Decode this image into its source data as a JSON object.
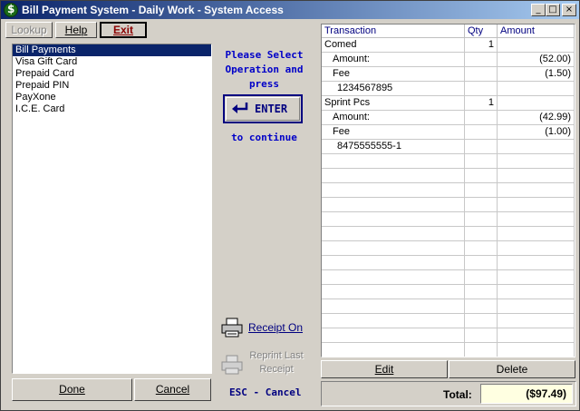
{
  "window": {
    "title": "Bill Payment System - Daily Work - System Access",
    "controls": {
      "minimize": "_",
      "maximize": "□",
      "close": "×"
    }
  },
  "menu": {
    "lookup": "Lookup",
    "help": "Help",
    "exit": "Exit"
  },
  "operations": [
    "Bill Payments",
    "Visa Gift Card",
    "Prepaid Card",
    "Prepaid PIN",
    "PayXone",
    "I.C.E. Card"
  ],
  "left_buttons": {
    "done": "Done",
    "cancel": "Cancel"
  },
  "center": {
    "prompt_line1": "Please Select",
    "prompt_line2": "Operation and",
    "prompt_line3": "press",
    "enter_label": "ENTER",
    "continue_text": "to continue",
    "receipt_on": "Receipt On",
    "reprint_line1": "Reprint Last",
    "reprint_line2": "Receipt",
    "esc_cancel": "ESC - Cancel"
  },
  "grid": {
    "headers": {
      "transaction": "Transaction",
      "qty": "Qty",
      "amount": "Amount"
    },
    "rows": [
      {
        "transaction": "Comed",
        "qty": "1",
        "amount": ""
      },
      {
        "transaction": "Amount:",
        "qty": "",
        "amount": "(52.00)"
      },
      {
        "transaction": "Fee",
        "qty": "",
        "amount": "(1.50)"
      },
      {
        "transaction": "1234567895",
        "qty": "",
        "amount": ""
      },
      {
        "transaction": "Sprint Pcs",
        "qty": "1",
        "amount": ""
      },
      {
        "transaction": "Amount:",
        "qty": "",
        "amount": "(42.99)"
      },
      {
        "transaction": "Fee",
        "qty": "",
        "amount": "(1.00)"
      },
      {
        "transaction": "8475555555-1",
        "qty": "",
        "amount": ""
      },
      {
        "transaction": "",
        "qty": "",
        "amount": ""
      },
      {
        "transaction": "",
        "qty": "",
        "amount": ""
      },
      {
        "transaction": "",
        "qty": "",
        "amount": ""
      },
      {
        "transaction": "",
        "qty": "",
        "amount": ""
      },
      {
        "transaction": "",
        "qty": "",
        "amount": ""
      },
      {
        "transaction": "",
        "qty": "",
        "amount": ""
      },
      {
        "transaction": "",
        "qty": "",
        "amount": ""
      },
      {
        "transaction": "",
        "qty": "",
        "amount": ""
      },
      {
        "transaction": "",
        "qty": "",
        "amount": ""
      },
      {
        "transaction": "",
        "qty": "",
        "amount": ""
      },
      {
        "transaction": "",
        "qty": "",
        "amount": ""
      },
      {
        "transaction": "",
        "qty": "",
        "amount": ""
      },
      {
        "transaction": "",
        "qty": "",
        "amount": ""
      },
      {
        "transaction": "",
        "qty": "",
        "amount": ""
      }
    ]
  },
  "right_buttons": {
    "edit": "Edit",
    "delete": "Delete"
  },
  "total": {
    "label": "Total:",
    "value": "($97.49)"
  }
}
